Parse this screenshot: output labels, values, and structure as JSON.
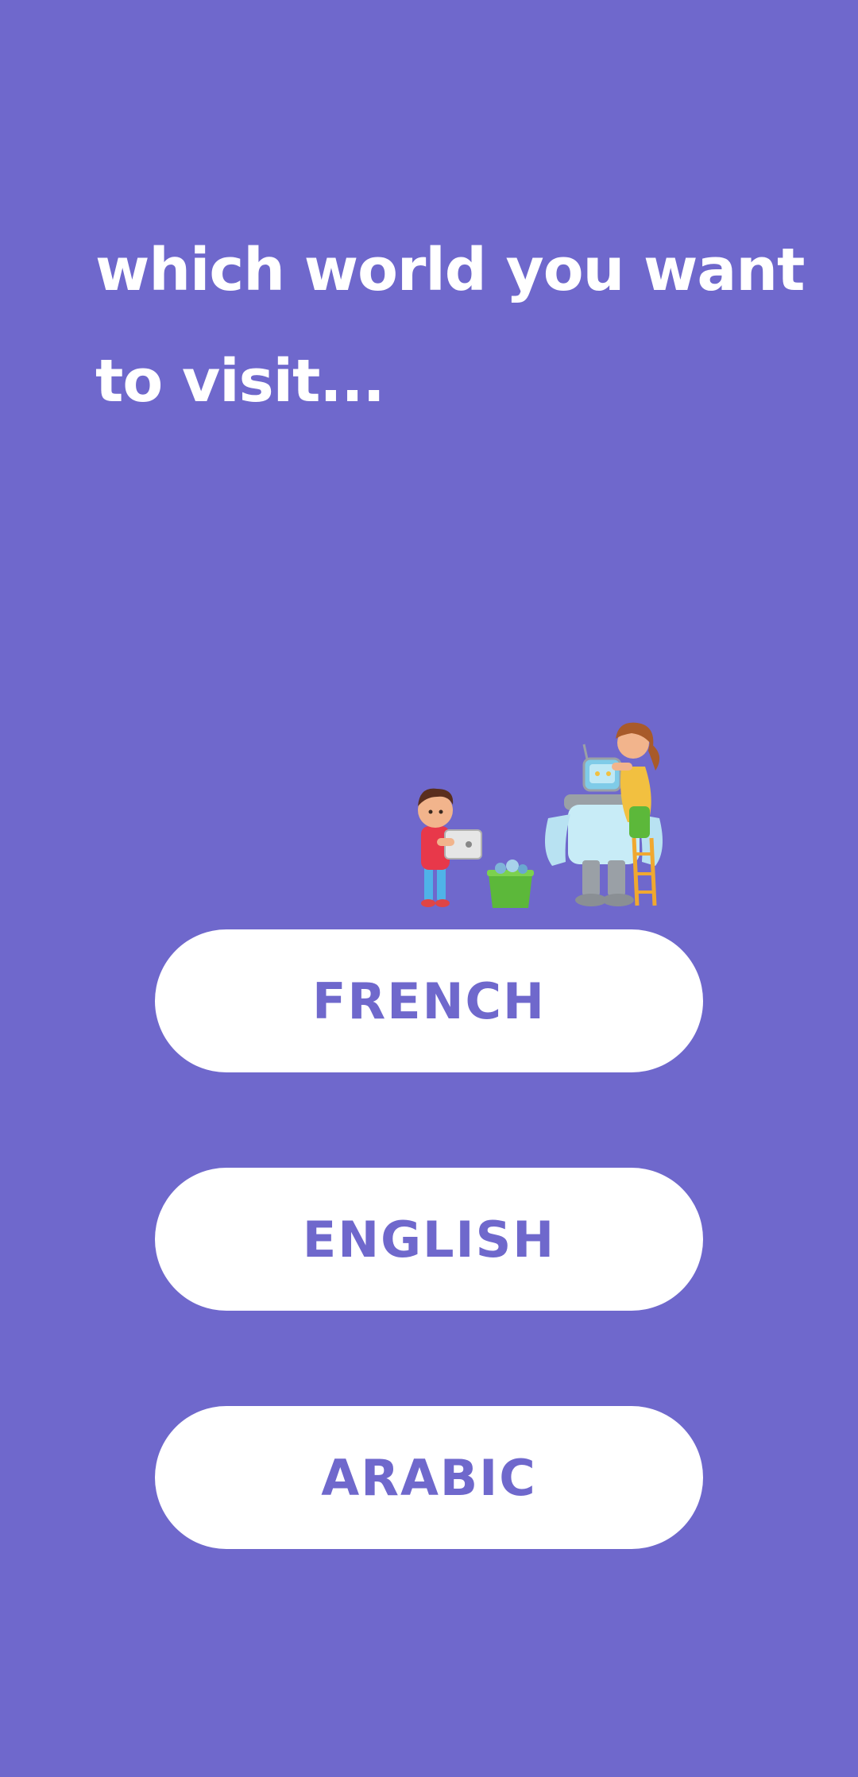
{
  "screen": {
    "title": "which world you want to visit...",
    "background_color": "#6f68cc",
    "accent_color": "#6f68cc"
  },
  "illustration": {
    "icon": "kids-building-robot-illustration"
  },
  "languages": [
    {
      "label": "FRENCH"
    },
    {
      "label": "ENGLISH"
    },
    {
      "label": "ARABIC"
    }
  ]
}
